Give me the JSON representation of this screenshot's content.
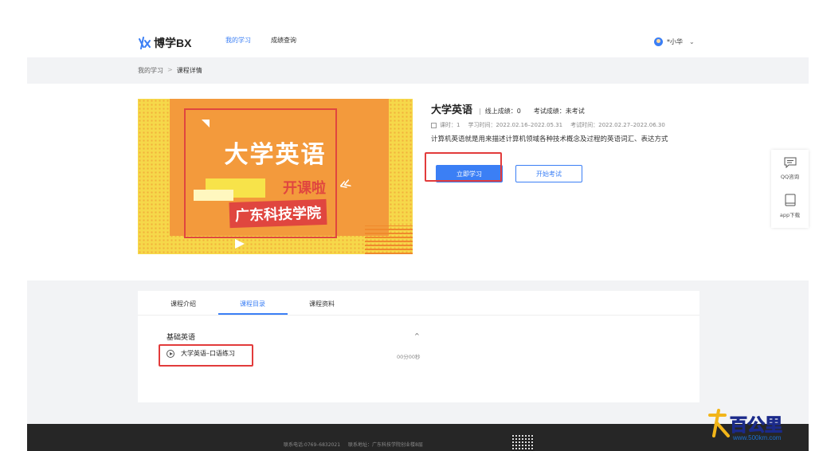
{
  "header": {
    "logo_text": "博学BX",
    "nav": [
      {
        "label": "我的学习",
        "active": true
      },
      {
        "label": "成绩查询",
        "active": false
      }
    ],
    "user_name": "*小华",
    "chevron": "⌄"
  },
  "breadcrumb": {
    "home": "我的学习",
    "sep": ">",
    "current": "课程详情"
  },
  "course": {
    "cover": {
      "title": "大学英语",
      "subtitle": "开课啦",
      "school": "广东科技学院"
    },
    "name": "大学英语",
    "online_score_label": "线上成绩：0",
    "exam_score_label": "考试成绩：未考试",
    "hours": "课时：1",
    "study_time": "学习时间：2022.02.16–2022.05.31",
    "exam_time": "考试时间：2022.02.27–2022.06.30",
    "description": "计算机英语就是用来描述计算机领域各种技术概念及过程的英语词汇、表达方式",
    "start_button": "立即学习",
    "exam_button": "开始考试"
  },
  "side_float": {
    "qq": "QQ咨询",
    "app": "app下载"
  },
  "tabs": [
    {
      "label": "课程介绍",
      "active": false
    },
    {
      "label": "课程目录",
      "active": true
    },
    {
      "label": "课程资料",
      "active": false
    }
  ],
  "catalog": {
    "chapter": "基础英语",
    "collapse": "^",
    "lessons": [
      {
        "title": "大学英语–口语练习",
        "duration": "00分00秒"
      }
    ]
  },
  "footer": {
    "phone": "联系电话:0769–6832021",
    "address": "联系地址：广东科技学院创业楼8层"
  },
  "watermark": {
    "text": "百公里",
    "url": "www.500km.com"
  },
  "colors": {
    "accent": "#3b7ff5",
    "highlight": "#e23b3b",
    "footer_bg": "#262626"
  }
}
